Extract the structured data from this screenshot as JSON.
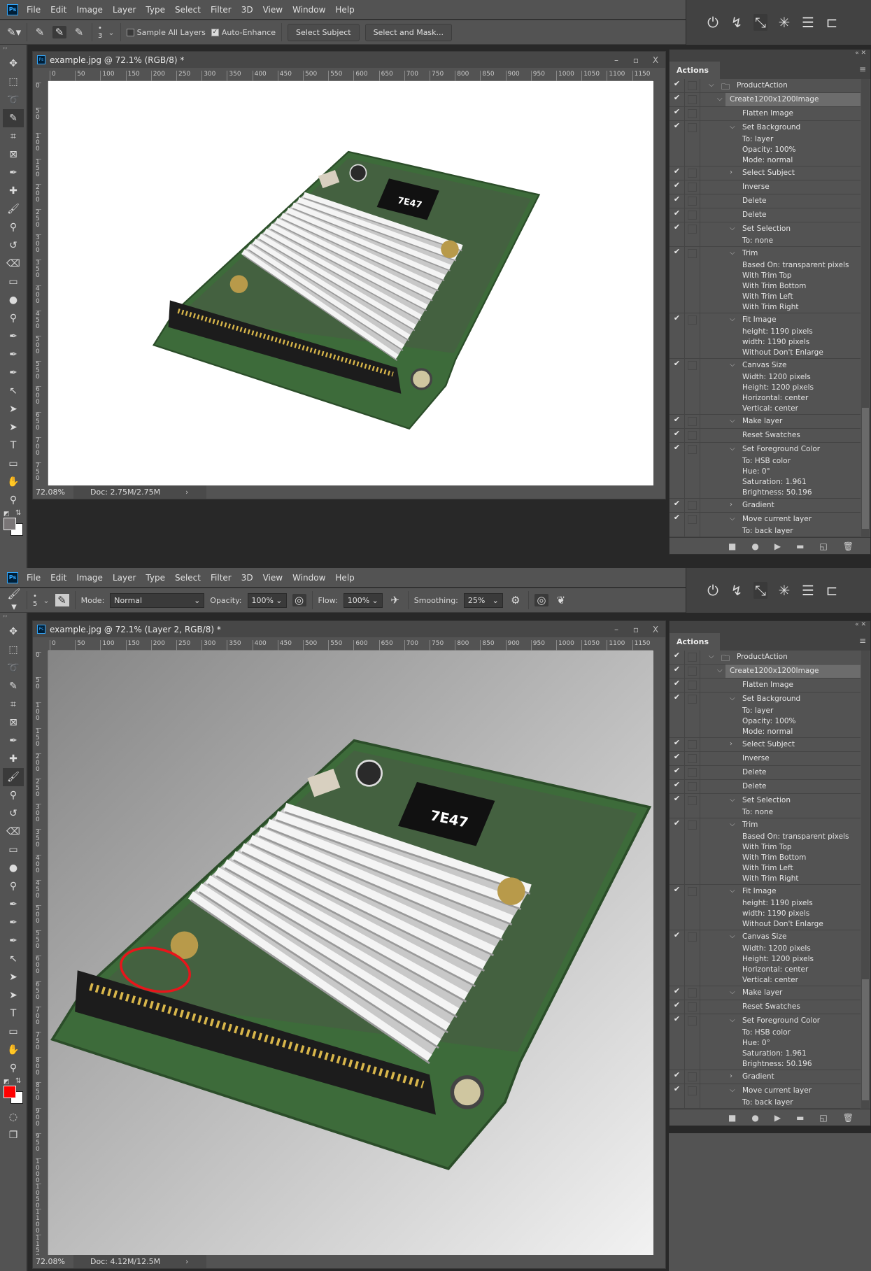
{
  "menu": [
    "File",
    "Edit",
    "Image",
    "Layer",
    "Type",
    "Select",
    "Filter",
    "3D",
    "View",
    "Window",
    "Help"
  ],
  "logo": "Ps",
  "colors": {
    "accent": "#31a8ff",
    "annotation": "#e8151b",
    "pcb_green": "#3d6b3a",
    "fg_top": "#7a7677",
    "fg_bottom": "#ff0000",
    "bg_swatch": "#ffffff"
  },
  "top": {
    "options": {
      "brush_size": "3",
      "sample_all_layers": {
        "label": "Sample All Layers",
        "checked": false
      },
      "auto_enhance": {
        "label": "Auto-Enhance",
        "checked": true
      },
      "select_subject": "Select Subject",
      "select_and_mask": "Select and Mask..."
    },
    "doc_title": "example.jpg @ 72.1% (RGB/8) *",
    "status_zoom": "72.08%",
    "status_doc": "Doc: 2.75M/2.75M",
    "vruler": [
      "0",
      "50",
      "100",
      "150",
      "200",
      "250",
      "300",
      "350",
      "400",
      "450",
      "500",
      "550",
      "600",
      "650",
      "700",
      "750"
    ]
  },
  "bottom": {
    "options": {
      "brush_size": "5",
      "mode_label": "Mode:",
      "mode_value": "Normal",
      "opacity_label": "Opacity:",
      "opacity_value": "100%",
      "flow_label": "Flow:",
      "flow_value": "100%",
      "smoothing_label": "Smoothing:",
      "smoothing_value": "25%"
    },
    "doc_title": "example.jpg @ 72.1% (Layer 2, RGB/8) *",
    "status_zoom": "72.08%",
    "status_doc": "Doc: 4.12M/12.5M",
    "vruler": [
      "0",
      "50",
      "100",
      "150",
      "200",
      "250",
      "300",
      "350",
      "400",
      "450",
      "500",
      "550",
      "600",
      "650",
      "700",
      "750",
      "800",
      "850",
      "900",
      "950",
      "1000",
      "1050",
      "1100",
      "1150"
    ]
  },
  "hruler": [
    "0",
    "50",
    "100",
    "150",
    "200",
    "250",
    "300",
    "350",
    "400",
    "450",
    "500",
    "550",
    "600",
    "650",
    "700",
    "750",
    "800",
    "850",
    "900",
    "950",
    "1000",
    "1050",
    "1100",
    "1150"
  ],
  "actions_panel": {
    "tab": "Actions",
    "items": [
      {
        "label": "ProductAction",
        "checked": true,
        "toggle": "open",
        "level": 0,
        "folder": true,
        "details": []
      },
      {
        "label": "Create1200x1200Image",
        "checked": true,
        "toggle": "open",
        "level": 1,
        "selected": true,
        "details": []
      },
      {
        "label": "Flatten Image",
        "checked": true,
        "toggle": "none",
        "level": 2,
        "details": []
      },
      {
        "label": "Set Background",
        "checked": true,
        "toggle": "open",
        "level": 2,
        "details": [
          "To: layer",
          "Opacity: 100%",
          "Mode: normal"
        ]
      },
      {
        "label": "Select Subject",
        "checked": true,
        "toggle": "closed",
        "level": 2,
        "details": []
      },
      {
        "label": "Inverse",
        "checked": true,
        "toggle": "none",
        "level": 2,
        "details": []
      },
      {
        "label": "Delete",
        "checked": true,
        "toggle": "none",
        "level": 2,
        "details": []
      },
      {
        "label": "Delete",
        "checked": true,
        "toggle": "none",
        "level": 2,
        "details": []
      },
      {
        "label": "Set Selection",
        "checked": true,
        "toggle": "open",
        "level": 2,
        "details": [
          "To: none"
        ]
      },
      {
        "label": "Trim",
        "checked": true,
        "toggle": "open",
        "level": 2,
        "details": [
          "Based On: transparent pixels",
          "With Trim Top",
          "With Trim Bottom",
          "With Trim Left",
          "With Trim Right"
        ]
      },
      {
        "label": "Fit Image",
        "checked": true,
        "toggle": "open",
        "level": 2,
        "details": [
          "height: 1190 pixels",
          "width: 1190 pixels",
          "Without Don't Enlarge"
        ]
      },
      {
        "label": "Canvas Size",
        "checked": true,
        "toggle": "open",
        "level": 2,
        "details": [
          "Width: 1200 pixels",
          "Height: 1200 pixels",
          "Horizontal: center",
          "Vertical: center"
        ]
      },
      {
        "label": "Make layer",
        "checked": true,
        "toggle": "open",
        "level": 2,
        "details": []
      },
      {
        "label": "Reset Swatches",
        "checked": true,
        "toggle": "none",
        "level": 2,
        "details": []
      },
      {
        "label": "Set Foreground Color",
        "checked": true,
        "toggle": "open",
        "level": 2,
        "details": [
          "To: HSB color",
          "Hue: 0°",
          "Saturation: 1.961",
          "Brightness: 50.196"
        ]
      },
      {
        "label": "Gradient",
        "checked": true,
        "toggle": "closed",
        "level": 2,
        "details": []
      },
      {
        "label": "Move current layer",
        "checked": true,
        "toggle": "open",
        "level": 2,
        "details": [
          "To: back layer"
        ]
      }
    ],
    "footer_icons": [
      "stop-icon",
      "record-icon",
      "play-icon",
      "new-set-icon",
      "new-action-icon",
      "trash-icon"
    ]
  },
  "chip_label": "7E47"
}
